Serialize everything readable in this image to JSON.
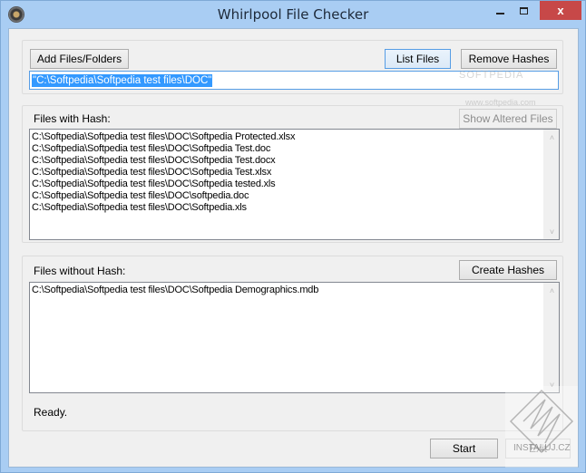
{
  "window": {
    "title": "Whirlpool File Checker",
    "app_icon": "whirlpool-app-icon",
    "controls": {
      "minimize": "minimize-icon",
      "maximize": "maximize-icon",
      "close": "close-icon",
      "close_glyph": "x"
    }
  },
  "top": {
    "add_button": "Add Files/Folders",
    "list_button": "List Files",
    "remove_button": "Remove Hashes",
    "path_value": "\"C:\\Softpedia\\Softpedia test files\\DOC\""
  },
  "with_hash": {
    "label": "Files with Hash:",
    "show_altered_button": "Show Altered Files",
    "files": [
      "C:\\Softpedia\\Softpedia test files\\DOC\\Softpedia Protected.xlsx",
      "C:\\Softpedia\\Softpedia test files\\DOC\\Softpedia Test.doc",
      "C:\\Softpedia\\Softpedia test files\\DOC\\Softpedia Test.docx",
      "C:\\Softpedia\\Softpedia test files\\DOC\\Softpedia Test.xlsx",
      "C:\\Softpedia\\Softpedia test files\\DOC\\Softpedia tested.xls",
      "C:\\Softpedia\\Softpedia test files\\DOC\\softpedia.doc",
      "C:\\Softpedia\\Softpedia test files\\DOC\\Softpedia.xls"
    ]
  },
  "without_hash": {
    "label": "Files without Hash:",
    "create_button": "Create Hashes",
    "files": [
      "C:\\Softpedia\\Softpedia test files\\DOC\\Softpedia Demographics.mdb"
    ]
  },
  "scroll": {
    "up_glyph": "˄",
    "down_glyph": "˅"
  },
  "status": "Ready.",
  "footer": {
    "start_button": "Start",
    "exit_button": "Exit"
  },
  "watermarks": {
    "softpedia": "SOFTPEDIA",
    "softpedia_url": "www.softpedia.com",
    "instaluj": "INSTALUJ.CZ"
  }
}
